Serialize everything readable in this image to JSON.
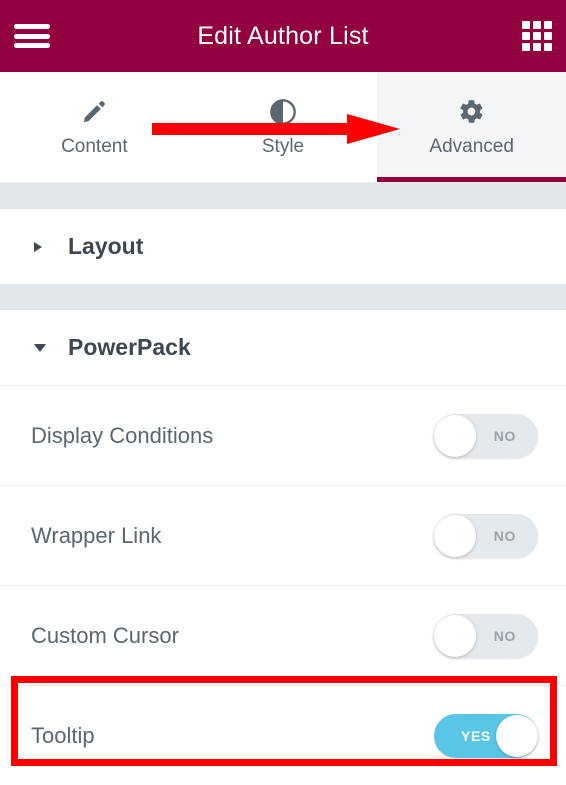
{
  "header": {
    "title": "Edit Author List",
    "menu_icon": "hamburger-menu-icon",
    "apps_icon": "grid-apps-icon",
    "background_color": "#93003f"
  },
  "tabs": [
    {
      "label": "Content",
      "icon": "pencil-icon",
      "active": false
    },
    {
      "label": "Style",
      "icon": "contrast-icon",
      "active": false
    },
    {
      "label": "Advanced",
      "icon": "gear-icon",
      "active": true
    }
  ],
  "sections": [
    {
      "title": "Layout",
      "expanded": false,
      "caret": "chevron-right-icon"
    },
    {
      "title": "PowerPack",
      "expanded": true,
      "caret": "chevron-down-icon"
    }
  ],
  "controls": [
    {
      "label": "Display Conditions",
      "state": "NO",
      "on": false
    },
    {
      "label": "Wrapper Link",
      "state": "NO",
      "on": false
    },
    {
      "label": "Custom Cursor",
      "state": "NO",
      "on": false
    },
    {
      "label": "Tooltip",
      "state": "YES",
      "on": true
    }
  ],
  "annotations": {
    "arrow": {
      "color": "#fe0000",
      "points_to": "Advanced"
    },
    "highlight": {
      "color": "#fe0000",
      "target": "Tooltip"
    }
  },
  "colors": {
    "brand_maroon": "#93003f",
    "switch_on": "#59c6e8",
    "switch_off": "#e5e9ec",
    "annotation_red": "#fe0000",
    "text_gray": "#5c6670"
  }
}
